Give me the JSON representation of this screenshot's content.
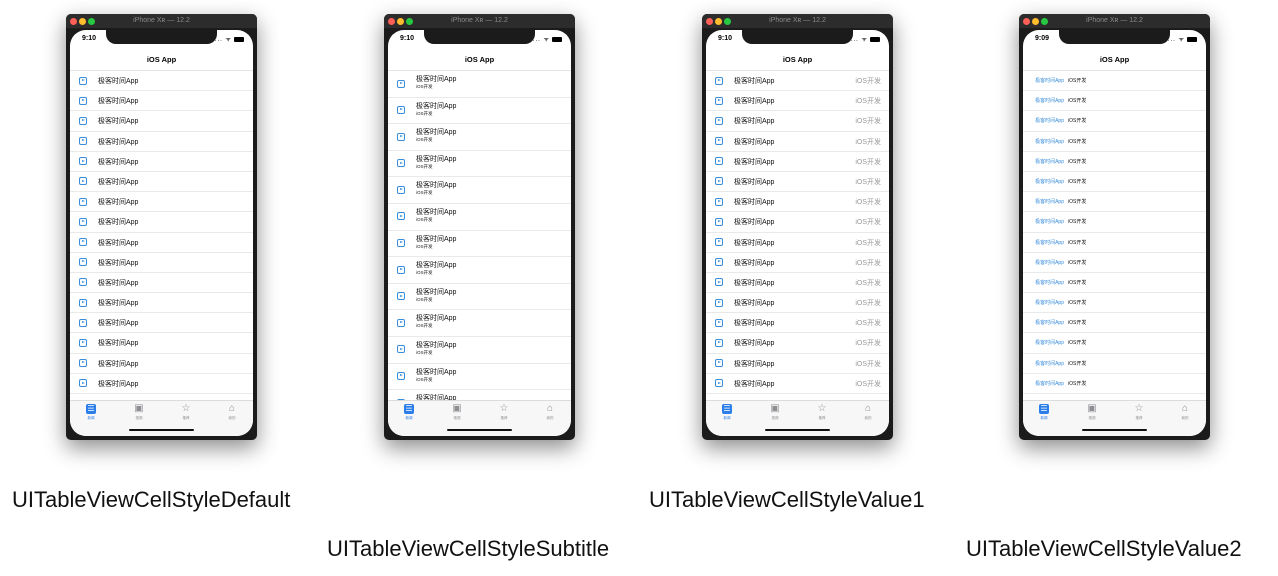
{
  "window_title": "iPhone Xʀ — 12.2",
  "nav_title": "iOS App",
  "cell_title": "极客时间App",
  "cell_subtitle": "iOS开发",
  "status_time_default": "9:10",
  "status_time_value2": "9:09",
  "status_icons": "... ᯤ",
  "tabs": [
    {
      "label": "新闻",
      "icon": "list-icon"
    },
    {
      "label": "视频",
      "icon": "video-icon"
    },
    {
      "label": "推荐",
      "icon": "star-icon"
    },
    {
      "label": "我的",
      "icon": "home-icon"
    }
  ],
  "phones": [
    {
      "style": "default",
      "time": "9:10",
      "caption": "UITableViewCellStyleDefault",
      "rows": 17
    },
    {
      "style": "subtitle",
      "time": "9:10",
      "caption": "UITableViewCellStyleSubtitle",
      "rows": 13
    },
    {
      "style": "value1",
      "time": "9:10",
      "caption": "UITableViewCellStyleValue1",
      "rows": 17
    },
    {
      "style": "value2",
      "time": "9:09",
      "caption": "UITableViewCellStyleValue2",
      "rows": 17
    }
  ],
  "colors": {
    "accent": "#2b7de9",
    "icon_blue": "#3a8ddb",
    "separator": "#e9e9e9"
  }
}
